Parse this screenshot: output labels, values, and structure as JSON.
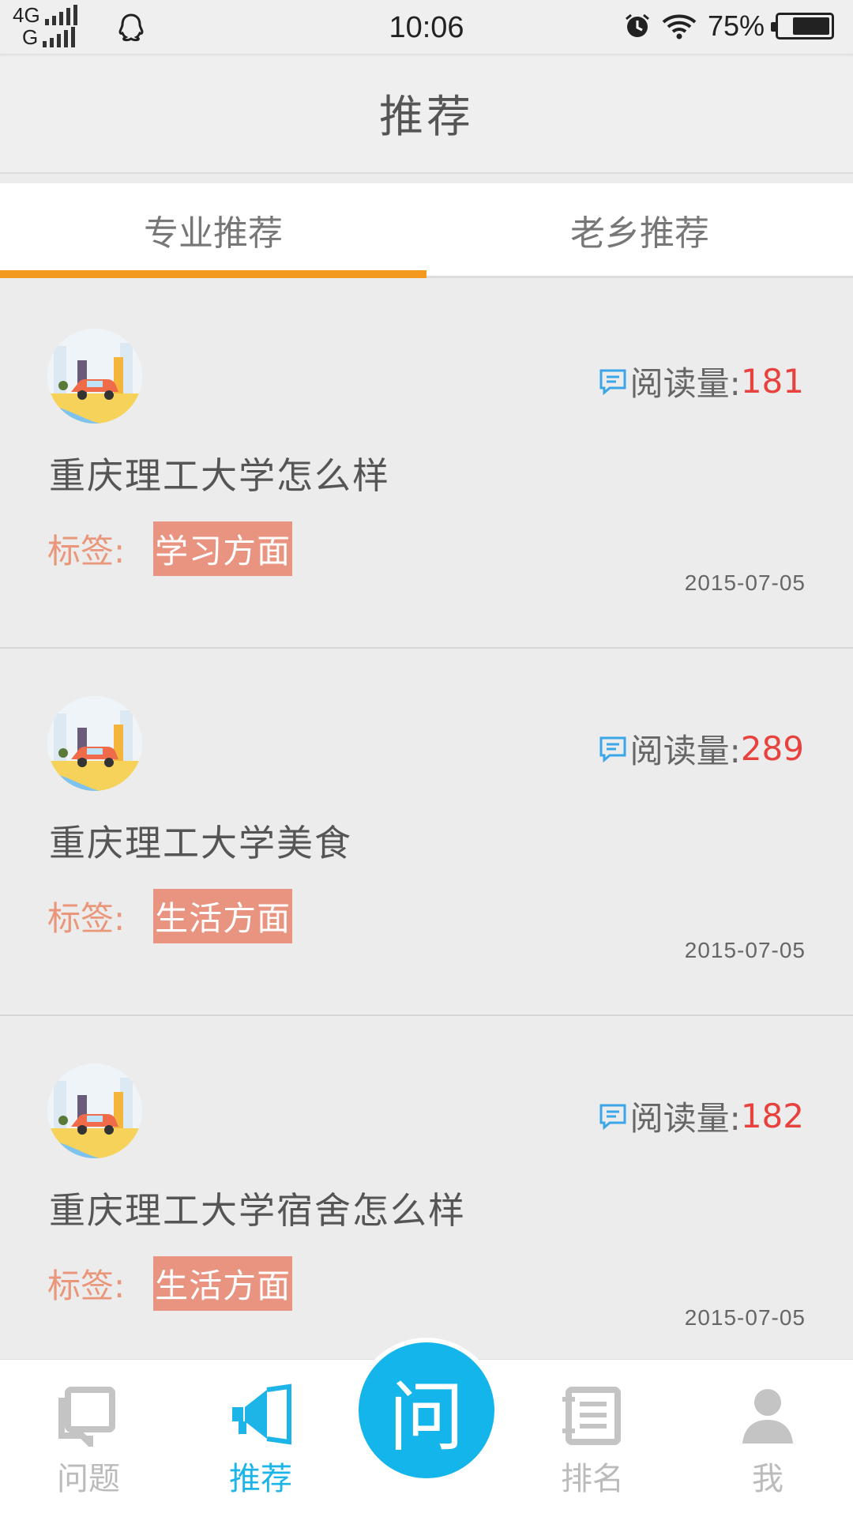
{
  "status_bar": {
    "network_top": "4G",
    "network_bottom": "G",
    "time": "10:06",
    "battery": "75%",
    "battery_level": 0.75
  },
  "header": {
    "title": "推荐"
  },
  "tabs": [
    {
      "label": "专业推荐",
      "active": true
    },
    {
      "label": "老乡推荐",
      "active": false
    }
  ],
  "posts": [
    {
      "read_label": "阅读量:",
      "reads": "181",
      "title": "重庆理工大学怎么样",
      "tag_label": "标签:",
      "tag": "学习方面",
      "date": "2015-07-05"
    },
    {
      "read_label": "阅读量:",
      "reads": "289",
      "title": "重庆理工大学美食",
      "tag_label": "标签:",
      "tag": "生活方面",
      "date": "2015-07-05"
    },
    {
      "read_label": "阅读量:",
      "reads": "182",
      "title": "重庆理工大学宿舍怎么样",
      "tag_label": "标签:",
      "tag": "生活方面",
      "date": "2015-07-05"
    }
  ],
  "bottom_nav": {
    "items": [
      {
        "label": "问题",
        "icon": "questions-icon"
      },
      {
        "label": "推荐",
        "icon": "megaphone-icon",
        "active": true
      },
      {
        "label": "排名",
        "icon": "ranking-icon"
      },
      {
        "label": "我",
        "icon": "profile-icon"
      }
    ],
    "ask_label": "问"
  },
  "colors": {
    "accent_tab": "#f39a1e",
    "read_count": "#e8423f",
    "tag_bg": "#e99480",
    "nav_active": "#1db4e8",
    "ask_button": "#13b5ea"
  }
}
